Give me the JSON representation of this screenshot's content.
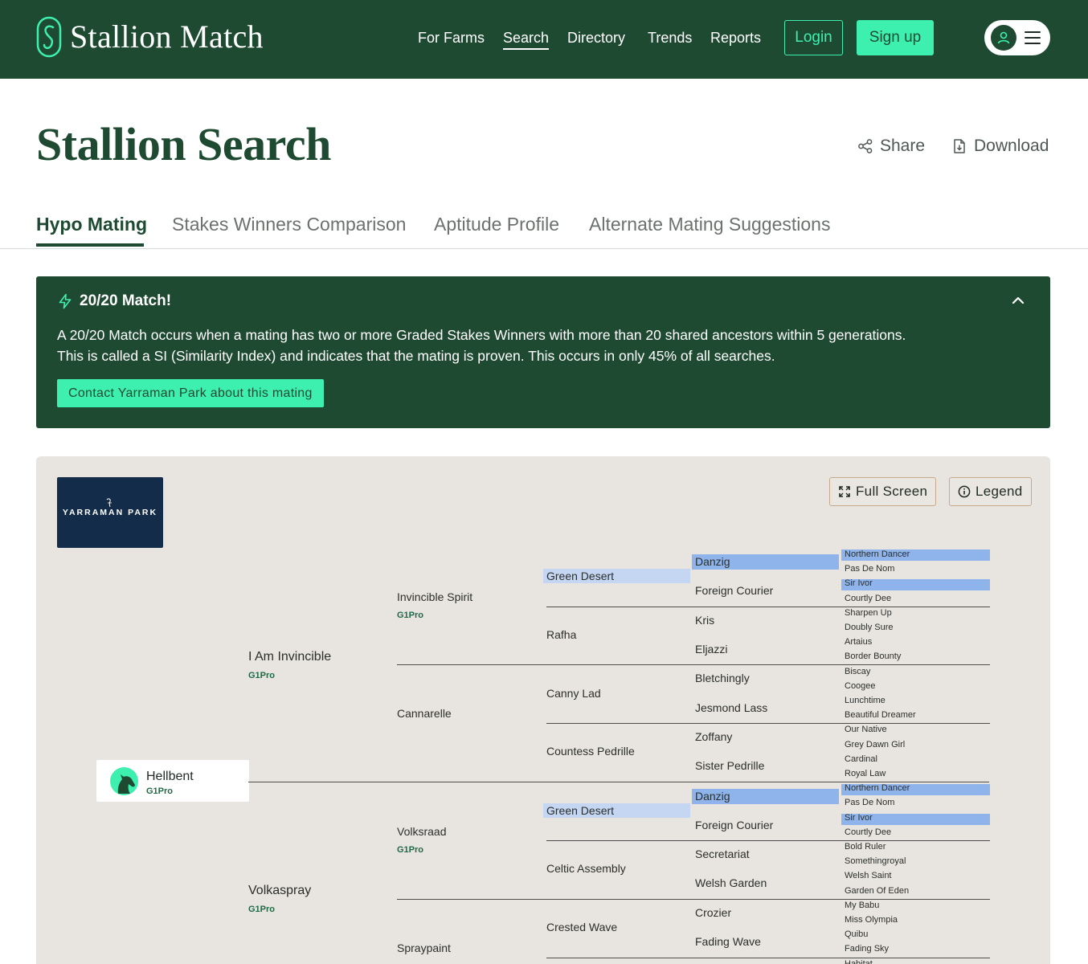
{
  "brand": {
    "name": "Stallion Match"
  },
  "nav": {
    "items": [
      "For Farms",
      "Search",
      "Directory",
      "Trends",
      "Reports"
    ],
    "active": "Search",
    "login": "Login",
    "signup": "Sign up"
  },
  "page": {
    "title": "Stallion Search",
    "share": "Share",
    "download": "Download"
  },
  "tabs": [
    "Hypo Mating",
    "Stakes Winners Comparison",
    "Aptitude Profile",
    "Alternate Mating Suggestions"
  ],
  "banner": {
    "title": "20/20 Match!",
    "line1": "A 20/20 Match occurs when a mating has two or more Graded Stakes Winners with more than 20 shared ancestors within 5 generations.",
    "line2": "This is called a SI (Similarity Index) and indicates that the mating is proven. This occurs in only 45% of all searches.",
    "cta": "Contact Yarraman Park about this mating"
  },
  "panel": {
    "farm_logo_text": "YARRAMAN PARK",
    "full_screen": "Full Screen",
    "legend": "Legend"
  },
  "pedigree": {
    "subject": {
      "name": "Hellbent",
      "tag": "G1Pro"
    },
    "gen1": [
      {
        "name": "I Am Invincible",
        "tag": "G1Pro"
      },
      {
        "name": "Volkaspray",
        "tag": "G1Pro"
      }
    ],
    "gen2": [
      {
        "name": "Invincible Spirit",
        "tag": "G1Pro"
      },
      {
        "name": "Cannarelle",
        "tag": ""
      },
      {
        "name": "Volksraad",
        "tag": "G1Pro"
      },
      {
        "name": "Spraypaint",
        "tag": ""
      }
    ],
    "gen3": [
      "Green Desert",
      "Rafha",
      "Canny Lad",
      "Countess Pedrille",
      "Green Desert",
      "Celtic Assembly",
      "Crested Wave"
    ],
    "gen4": [
      "Danzig",
      "Foreign Courier",
      "Kris",
      "Eljazzi",
      "Bletchingly",
      "Jesmond Lass",
      "Zoffany",
      "Sister Pedrille",
      "Danzig",
      "Foreign Courier",
      "Secretariat",
      "Welsh Garden",
      "Crozier",
      "Fading Wave"
    ],
    "gen5": [
      "Northern Dancer",
      "Pas De Nom",
      "Sir Ivor",
      "Courtly Dee",
      "Sharpen Up",
      "Doubly Sure",
      "Artaius",
      "Border Bounty",
      "Biscay",
      "Coogee",
      "Lunchtime",
      "Beautiful Dreamer",
      "Our Native",
      "Grey Dawn Girl",
      "Cardinal",
      "Royal Law",
      "Northern Dancer",
      "Pas De Nom",
      "Sir Ivor",
      "Courtly Dee",
      "Bold Ruler",
      "Somethingroyal",
      "Welsh Saint",
      "Garden Of Eden",
      "My Babu",
      "Miss Olympia",
      "Quibu",
      "Fading Sky",
      "Habitat"
    ]
  },
  "colors": {
    "brand_green": "#1f4a32",
    "accent_mint": "#3ef0b0",
    "highlight_strong": "#8fb4ec",
    "highlight_soft": "#c4d6f1"
  }
}
